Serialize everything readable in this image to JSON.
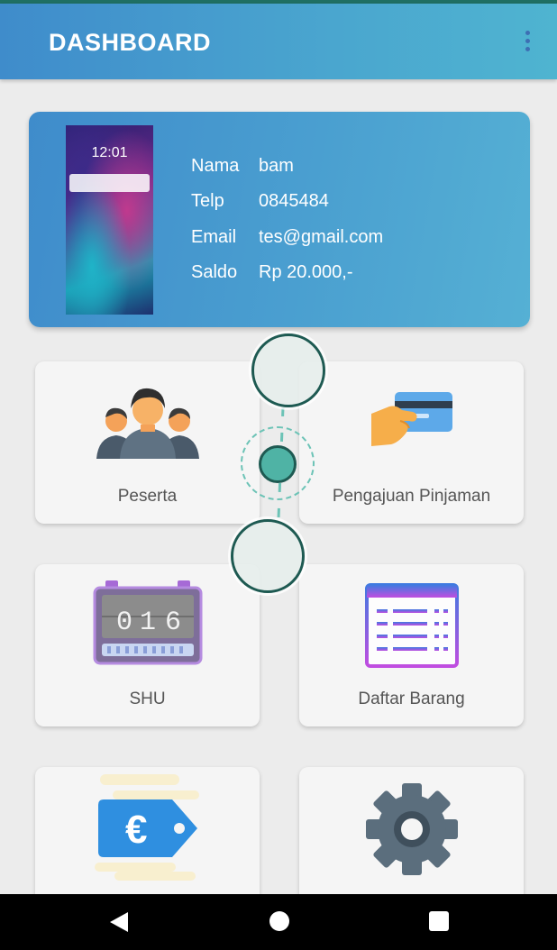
{
  "appbar": {
    "title": "DASHBOARD",
    "overflow_icon": "more-vert-icon"
  },
  "profile": {
    "rows": [
      {
        "label": "Nama",
        "value": "bam"
      },
      {
        "label": "Telp",
        "value": "0845484"
      },
      {
        "label": "Email",
        "value": "tes@gmail.com"
      },
      {
        "label": "Saldo",
        "value": "Rp 20.000,-"
      }
    ],
    "photo": {
      "clock": "12:01"
    }
  },
  "menu": [
    {
      "label": "Peserta",
      "icon": "people-group-icon"
    },
    {
      "label": "Pengajuan Pinjaman",
      "icon": "hand-card-icon"
    },
    {
      "label": "SHU",
      "icon": "flip-counter-icon"
    },
    {
      "label": "Daftar Barang",
      "icon": "list-window-icon"
    },
    {
      "label": "",
      "icon": "euro-tag-icon"
    },
    {
      "label": "",
      "icon": "gear-icon"
    }
  ],
  "navbar": {
    "back_icon": "back-triangle-icon",
    "home_icon": "home-circle-icon",
    "recent_icon": "recent-square-icon"
  },
  "colors": {
    "appbar": "#4aa6cf",
    "card": "#4a9fd0",
    "accent": "#1e5a52"
  }
}
